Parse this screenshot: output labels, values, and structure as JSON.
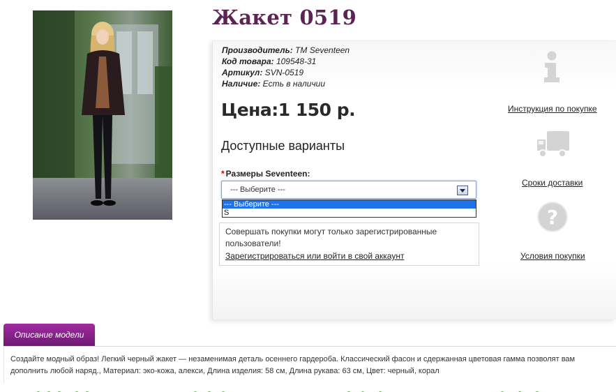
{
  "product": {
    "title": "Жакет 0519",
    "specs": [
      {
        "key": "Производитель:",
        "value": "TM Seventeen"
      },
      {
        "key": "Код товара:",
        "value": "109548-31"
      },
      {
        "key": "Артикул:",
        "value": "SVN-0519"
      },
      {
        "key": "Наличие:",
        "value": "Есть в наличии"
      }
    ],
    "price": "Цена:1 150 р.",
    "variants_heading": "Доступные варианты",
    "size_label": "Размеры Seventeen:",
    "required_mark": "*",
    "size_select": {
      "value": "--- Выберите ---",
      "options": [
        "--- Выберите ---",
        "S"
      ]
    },
    "notice": {
      "text": "Совершать покупки могут только зарегистрированные пользователи!",
      "link": "Зарегистрироваться или войти в свой аккаунт"
    }
  },
  "side_links": [
    {
      "label": "Инструкция по покупке",
      "icon": "info-icon"
    },
    {
      "label": "Сроки доставки",
      "icon": "delivery-truck-icon"
    },
    {
      "label": "Условия покупки",
      "icon": "question-icon"
    }
  ],
  "description": {
    "tab_label": "Описание модели",
    "text": "Создайте модный образ! Легкий черный жакет — незаменимая деталь осеннего гардероба. Классический фасон и сдержанная цветовая гамма позволят вам дополнить любой наряд., Материал: эко-кожа, алекси, Длина изделия: 58 см, Длина рукава: 63 см, Цвет: черный, корал"
  },
  "colors": {
    "title": "#5b2454",
    "tab": "#8a2290",
    "select_highlight": "#1e73e8",
    "required": "#cc0000"
  }
}
